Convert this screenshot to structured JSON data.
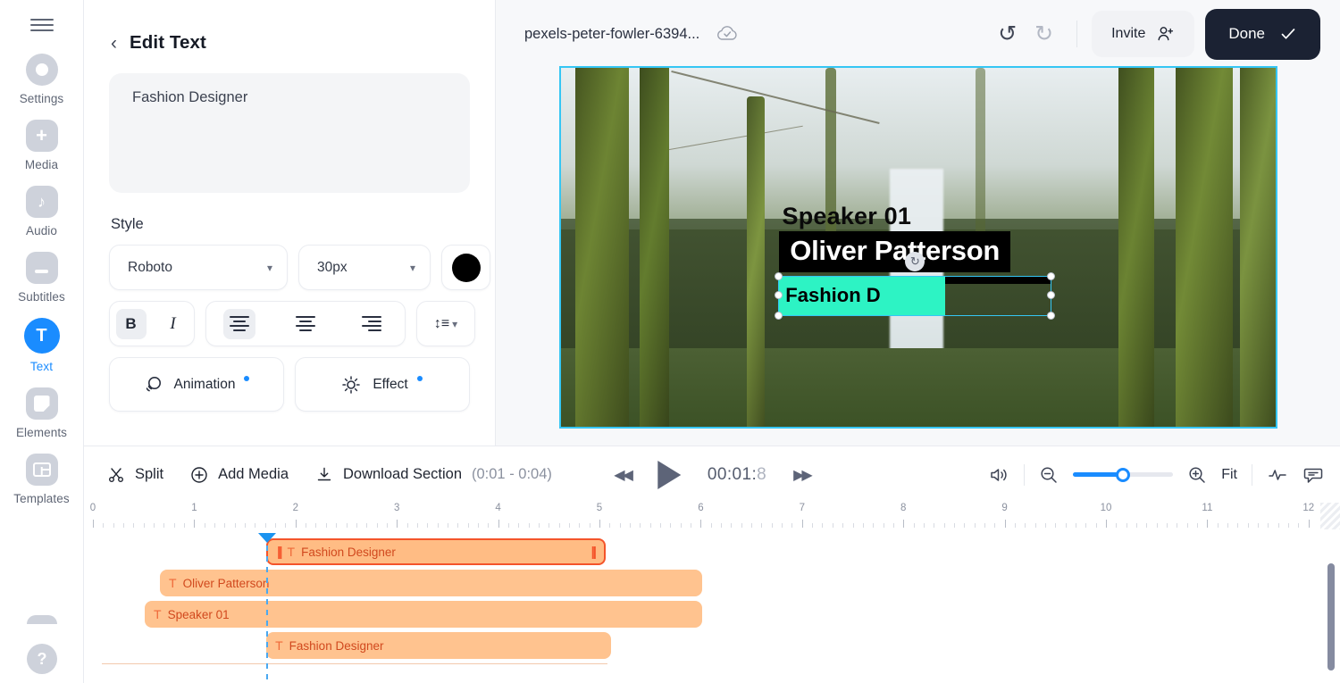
{
  "sidebar": {
    "menu_icon": "hamburger-icon",
    "items": [
      {
        "label": "Settings",
        "icon": "gear-icon",
        "active": false
      },
      {
        "label": "Media",
        "icon": "plus-icon",
        "active": false
      },
      {
        "label": "Audio",
        "icon": "music-note-icon",
        "active": false
      },
      {
        "label": "Subtitles",
        "icon": "subtitles-icon",
        "active": false
      },
      {
        "label": "Text",
        "icon": "text-icon",
        "active": true
      },
      {
        "label": "Elements",
        "icon": "elements-icon",
        "active": false
      },
      {
        "label": "Templates",
        "icon": "templates-icon",
        "active": false
      }
    ],
    "help_label": "?"
  },
  "panel": {
    "back_icon": "chevron-left-icon",
    "title": "Edit Text",
    "textarea_value": "Fashion Designer",
    "style_label": "Style",
    "font_family": "Roboto",
    "font_size": "30px",
    "text_color": "#000000",
    "bold_label": "B",
    "italic_label": "I",
    "align_left": "align-left",
    "align_center": "align-center",
    "align_right": "align-right",
    "line_height_icon": "line-height-icon",
    "animation_label": "Animation",
    "effect_label": "Effect"
  },
  "header": {
    "filename": "pexels-peter-fowler-6394...",
    "cloud_icon": "cloud-saved-icon",
    "undo_icon": "undo-arrow-icon",
    "redo_icon": "redo-arrow-icon",
    "invite_label": "Invite",
    "invite_icon": "add-person-icon",
    "done_label": "Done",
    "done_icon": "check-icon"
  },
  "preview": {
    "overlays": {
      "speaker": "Speaker 01",
      "name": "Oliver Patterson",
      "selected_text": "Fashion D"
    },
    "selection_color": "#35c6f4",
    "highlight_color": "#2df3c4",
    "rotate_icon": "rotate-handle-icon"
  },
  "timeline": {
    "split_label": "Split",
    "split_icon": "scissors-icon",
    "add_media_label": "Add Media",
    "add_media_icon": "plus-circle-icon",
    "download_label": "Download Section",
    "download_range": "(0:01 - 0:04)",
    "download_icon": "download-icon",
    "prev_icon": "skip-back-icon",
    "play_icon": "play-icon",
    "next_icon": "skip-forward-icon",
    "timecode": "00:01:",
    "timecode_frames": "8",
    "volume_icon": "volume-icon",
    "zoom_out_icon": "zoom-out-icon",
    "zoom_in_icon": "zoom-in-icon",
    "zoom_value": 50,
    "fit_label": "Fit",
    "waveform_icon": "waveform-icon",
    "comment_icon": "comment-icon",
    "ruler_ticks": [
      "0",
      "1",
      "2",
      "3",
      "4",
      "5",
      "6",
      "7",
      "8",
      "9",
      "10",
      "11",
      "12"
    ],
    "playhead_seconds": 1.8,
    "clips": [
      {
        "label": "Fashion Designer",
        "icon": "text-clip-icon",
        "start": 1.8,
        "end": 5.15,
        "selected": true,
        "track": 0
      },
      {
        "label": "Oliver Patterson",
        "icon": "text-clip-icon",
        "start": 0.75,
        "end": 6.1,
        "selected": false,
        "track": 1
      },
      {
        "label": "Speaker 01",
        "icon": "text-clip-icon",
        "start": 0.6,
        "end": 6.1,
        "selected": false,
        "track": 2
      },
      {
        "label": "Fashion Designer",
        "icon": "text-clip-icon",
        "start": 1.8,
        "end": 5.2,
        "selected": false,
        "track": 3
      }
    ]
  }
}
